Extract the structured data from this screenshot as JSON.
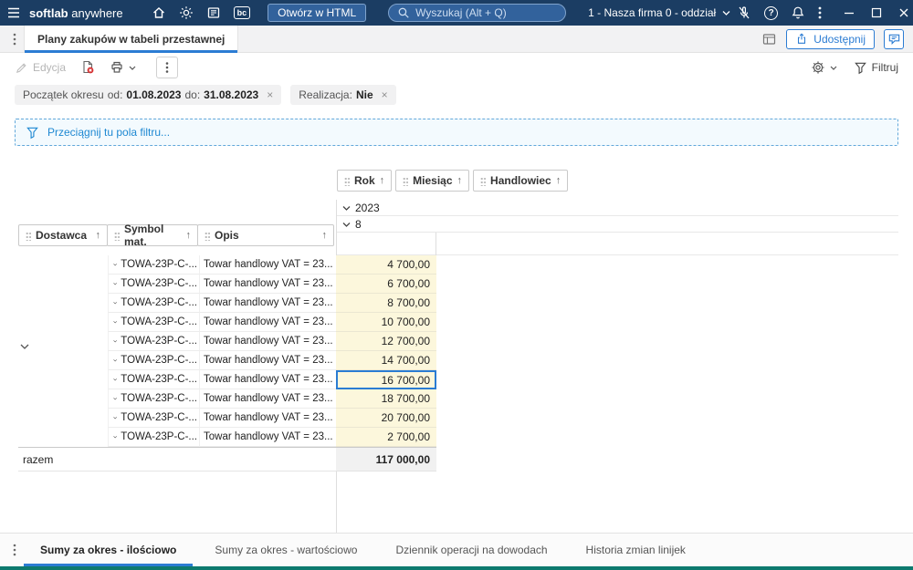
{
  "colors": {
    "topbar_bg": "#1b3d63",
    "topbar_control_bg": "#32629c",
    "accent_blue": "#2b7cd3",
    "value_cell_bg": "#fcf7dc",
    "selected_cell_border": "#2b7cd3",
    "status_strip": "#0d7a6e"
  },
  "glyphs": {
    "close": "×",
    "sort_asc": "↑",
    "help": "?",
    "bc": "bc"
  },
  "topbar": {
    "app_name_bold": "softlab",
    "app_name_rest": "anywhere",
    "open_html_button": "Otwórz w HTML",
    "search_placeholder": "Wyszukaj (Alt + Q)",
    "company_selector": "1 - Nasza firma 0 - oddział"
  },
  "tab_bar": {
    "active_tab": "Plany zakupów w tabeli przestawnej",
    "share_button": "Udostępnij"
  },
  "toolbar": {
    "edit_button": "Edycja",
    "filter_button": "Filtruj"
  },
  "filters": {
    "period_chip": {
      "label": "Początek okresu",
      "from_label": "od:",
      "from_value": "01.08.2023",
      "to_label": "do:",
      "to_value": "31.08.2023"
    },
    "realization_chip": {
      "label": "Realizacja:",
      "value": "Nie"
    }
  },
  "drop_zone": {
    "text": "Przeciągnij tu pola filtru..."
  },
  "pivot": {
    "column_fields": [
      "Rok",
      "Miesiąc",
      "Handlowiec"
    ],
    "row_fields": [
      "Dostawca",
      "Symbol mat.",
      "Opis"
    ],
    "group_rows": [
      "2023",
      "8"
    ],
    "rows": [
      {
        "symbol": "TOWA-23P-C-...",
        "description": "Towar handlowy VAT = 23...",
        "value": "4 700,00",
        "selected": false
      },
      {
        "symbol": "TOWA-23P-C-...",
        "description": "Towar handlowy VAT = 23...",
        "value": "6 700,00",
        "selected": false
      },
      {
        "symbol": "TOWA-23P-C-...",
        "description": "Towar handlowy VAT = 23...",
        "value": "8 700,00",
        "selected": false
      },
      {
        "symbol": "TOWA-23P-C-...",
        "description": "Towar handlowy VAT = 23...",
        "value": "10 700,00",
        "selected": false
      },
      {
        "symbol": "TOWA-23P-C-...",
        "description": "Towar handlowy VAT = 23...",
        "value": "12 700,00",
        "selected": false
      },
      {
        "symbol": "TOWA-23P-C-...",
        "description": "Towar handlowy VAT = 23...",
        "value": "14 700,00",
        "selected": false
      },
      {
        "symbol": "TOWA-23P-C-...",
        "description": "Towar handlowy VAT = 23...",
        "value": "16 700,00",
        "selected": true
      },
      {
        "symbol": "TOWA-23P-C-...",
        "description": "Towar handlowy VAT = 23...",
        "value": "18 700,00",
        "selected": false
      },
      {
        "symbol": "TOWA-23P-C-...",
        "description": "Towar handlowy VAT = 23...",
        "value": "20 700,00",
        "selected": false
      },
      {
        "symbol": "TOWA-23P-C-...",
        "description": "Towar handlowy VAT = 23...",
        "value": "2 700,00",
        "selected": false
      }
    ],
    "total_label": "razem",
    "total_value": "117 000,00"
  },
  "bottom_tabs": [
    {
      "label": "Sumy za okres - ilościowo",
      "active": true
    },
    {
      "label": "Sumy za okres - wartościowo",
      "active": false
    },
    {
      "label": "Dziennik operacji na dowodach",
      "active": false
    },
    {
      "label": "Historia zmian linijek",
      "active": false
    }
  ]
}
